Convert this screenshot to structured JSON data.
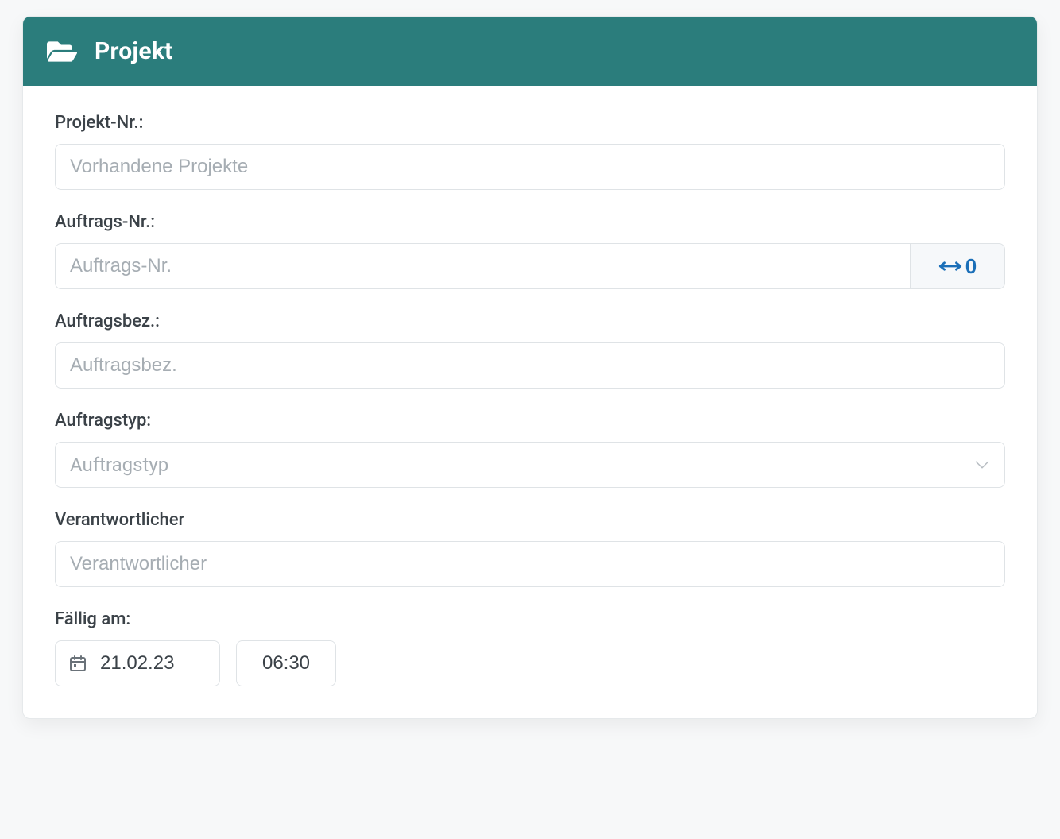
{
  "header": {
    "title": "Projekt"
  },
  "fields": {
    "project_nr": {
      "label": "Projekt-Nr.:",
      "placeholder": "Vorhandene Projekte",
      "value": ""
    },
    "order_nr": {
      "label": "Auftrags-Nr.:",
      "placeholder": "Auftrags-Nr.",
      "value": "",
      "addon_text": "0"
    },
    "order_name": {
      "label": "Auftragsbez.:",
      "placeholder": "Auftragsbez.",
      "value": ""
    },
    "order_type": {
      "label": "Auftragstyp:",
      "placeholder": "Auftragstyp",
      "value": ""
    },
    "responsible": {
      "label": "Verantwortlicher",
      "placeholder": "Verantwortlicher",
      "value": ""
    },
    "due": {
      "label": "Fällig am:",
      "date": "21.02.23",
      "time": "06:30"
    }
  },
  "colors": {
    "header_bg": "#2b7d7c",
    "accent": "#1b6fb8"
  }
}
